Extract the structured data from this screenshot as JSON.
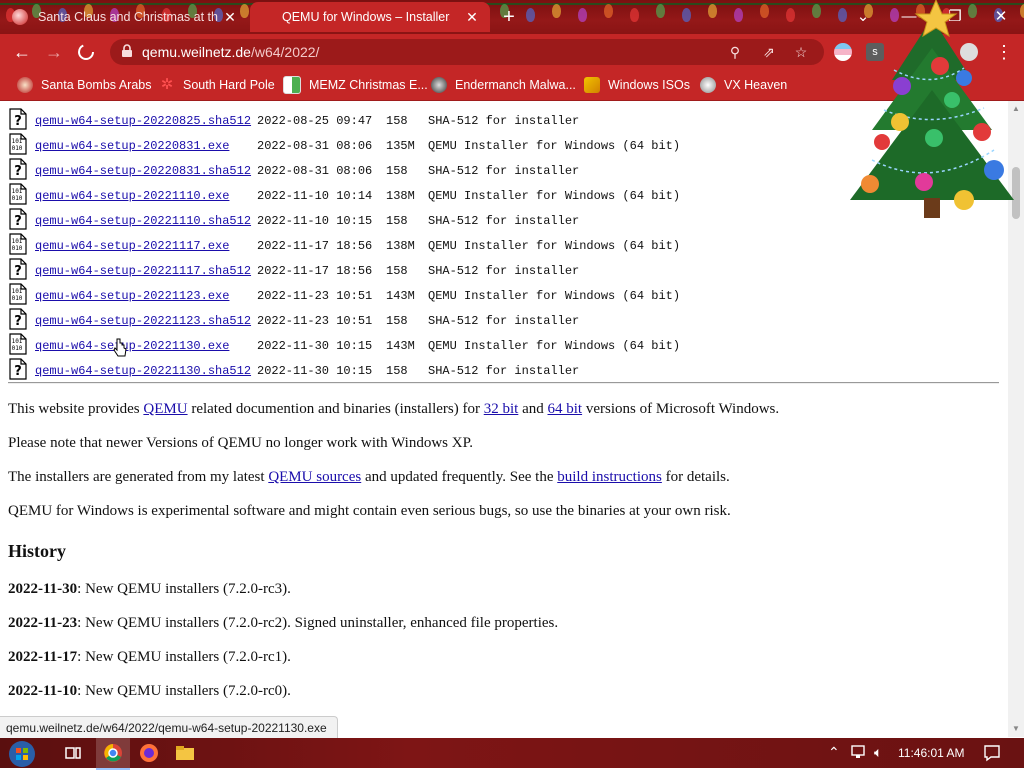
{
  "browser": {
    "tabs": [
      {
        "title": "Santa Claus and Christmas at the",
        "active": false
      },
      {
        "title": "QEMU for Windows – Installers (",
        "active": true
      }
    ],
    "url_domain": "qemu.weilnetz.de",
    "url_path": "/w64/2022/",
    "bookmarks": [
      {
        "label": "Santa Bombs Arabs"
      },
      {
        "label": "South Hard Pole"
      },
      {
        "label": "MEMZ Christmas E..."
      },
      {
        "label": "Endermanch Malwa..."
      },
      {
        "label": "Windows ISOs"
      },
      {
        "label": "VX Heaven"
      }
    ]
  },
  "files": [
    {
      "name": "qemu-w64-setup-20220825.sha512",
      "date": "2022-08-25 09:47",
      "size": "158",
      "desc": "SHA-512 for installer",
      "type": "unknown"
    },
    {
      "name": "qemu-w64-setup-20220831.exe",
      "date": "2022-08-31 08:06",
      "size": "135M",
      "desc": "QEMU Installer for Windows (64 bit)",
      "type": "binary"
    },
    {
      "name": "qemu-w64-setup-20220831.sha512",
      "date": "2022-08-31 08:06",
      "size": "158",
      "desc": "SHA-512 for installer",
      "type": "unknown"
    },
    {
      "name": "qemu-w64-setup-20221110.exe",
      "date": "2022-11-10 10:14",
      "size": "138M",
      "desc": "QEMU Installer for Windows (64 bit)",
      "type": "binary"
    },
    {
      "name": "qemu-w64-setup-20221110.sha512",
      "date": "2022-11-10 10:15",
      "size": "158",
      "desc": "SHA-512 for installer",
      "type": "unknown"
    },
    {
      "name": "qemu-w64-setup-20221117.exe",
      "date": "2022-11-17 18:56",
      "size": "138M",
      "desc": "QEMU Installer for Windows (64 bit)",
      "type": "binary"
    },
    {
      "name": "qemu-w64-setup-20221117.sha512",
      "date": "2022-11-17 18:56",
      "size": "158",
      "desc": "SHA-512 for installer",
      "type": "unknown"
    },
    {
      "name": "qemu-w64-setup-20221123.exe",
      "date": "2022-11-23 10:51",
      "size": "143M",
      "desc": "QEMU Installer for Windows (64 bit)",
      "type": "binary"
    },
    {
      "name": "qemu-w64-setup-20221123.sha512",
      "date": "2022-11-23 10:51",
      "size": "158",
      "desc": "SHA-512 for installer",
      "type": "unknown"
    },
    {
      "name": "qemu-w64-setup-20221130.exe",
      "date": "2022-11-30 10:15",
      "size": "143M",
      "desc": "QEMU Installer for Windows (64 bit)",
      "type": "binary"
    },
    {
      "name": "qemu-w64-setup-20221130.sha512",
      "date": "2022-11-30 10:15",
      "size": "158",
      "desc": "SHA-512 for installer",
      "type": "unknown"
    }
  ],
  "intro": {
    "p1_a": "This website provides ",
    "p1_link1": "QEMU",
    "p1_b": " related documention and binaries (installers) for ",
    "p1_link2": "32 bit",
    "p1_c": " and ",
    "p1_link3": "64 bit",
    "p1_d": " versions of Microsoft Windows.",
    "p2": "Please note that newer Versions of QEMU no longer work with Windows XP.",
    "p3_a": "The installers are generated from my latest ",
    "p3_link1": "QEMU sources",
    "p3_b": " and updated frequently. See the ",
    "p3_link2": "build instructions",
    "p3_c": " for details.",
    "p4": "QEMU for Windows is experimental software and might contain even serious bugs, so use the binaries at your own risk."
  },
  "history": {
    "heading": "History",
    "entries": [
      {
        "date": "2022-11-30",
        "text": ": New QEMU installers (7.2.0-rc3)."
      },
      {
        "date": "2022-11-23",
        "text": ": New QEMU installers (7.2.0-rc2). Signed uninstaller, enhanced file properties."
      },
      {
        "date": "2022-11-17",
        "text": ": New QEMU installers (7.2.0-rc1)."
      },
      {
        "date": "2022-11-10",
        "text": ": New QEMU installers (7.2.0-rc0)."
      }
    ]
  },
  "status_url": "qemu.weilnetz.de/w64/2022/qemu-w64-setup-20221130.exe",
  "taskbar": {
    "clock": "11:46:01 AM"
  },
  "colors": {
    "theme": "#c42626",
    "link": "#1a0dab",
    "taskbar": "#6e1313"
  }
}
